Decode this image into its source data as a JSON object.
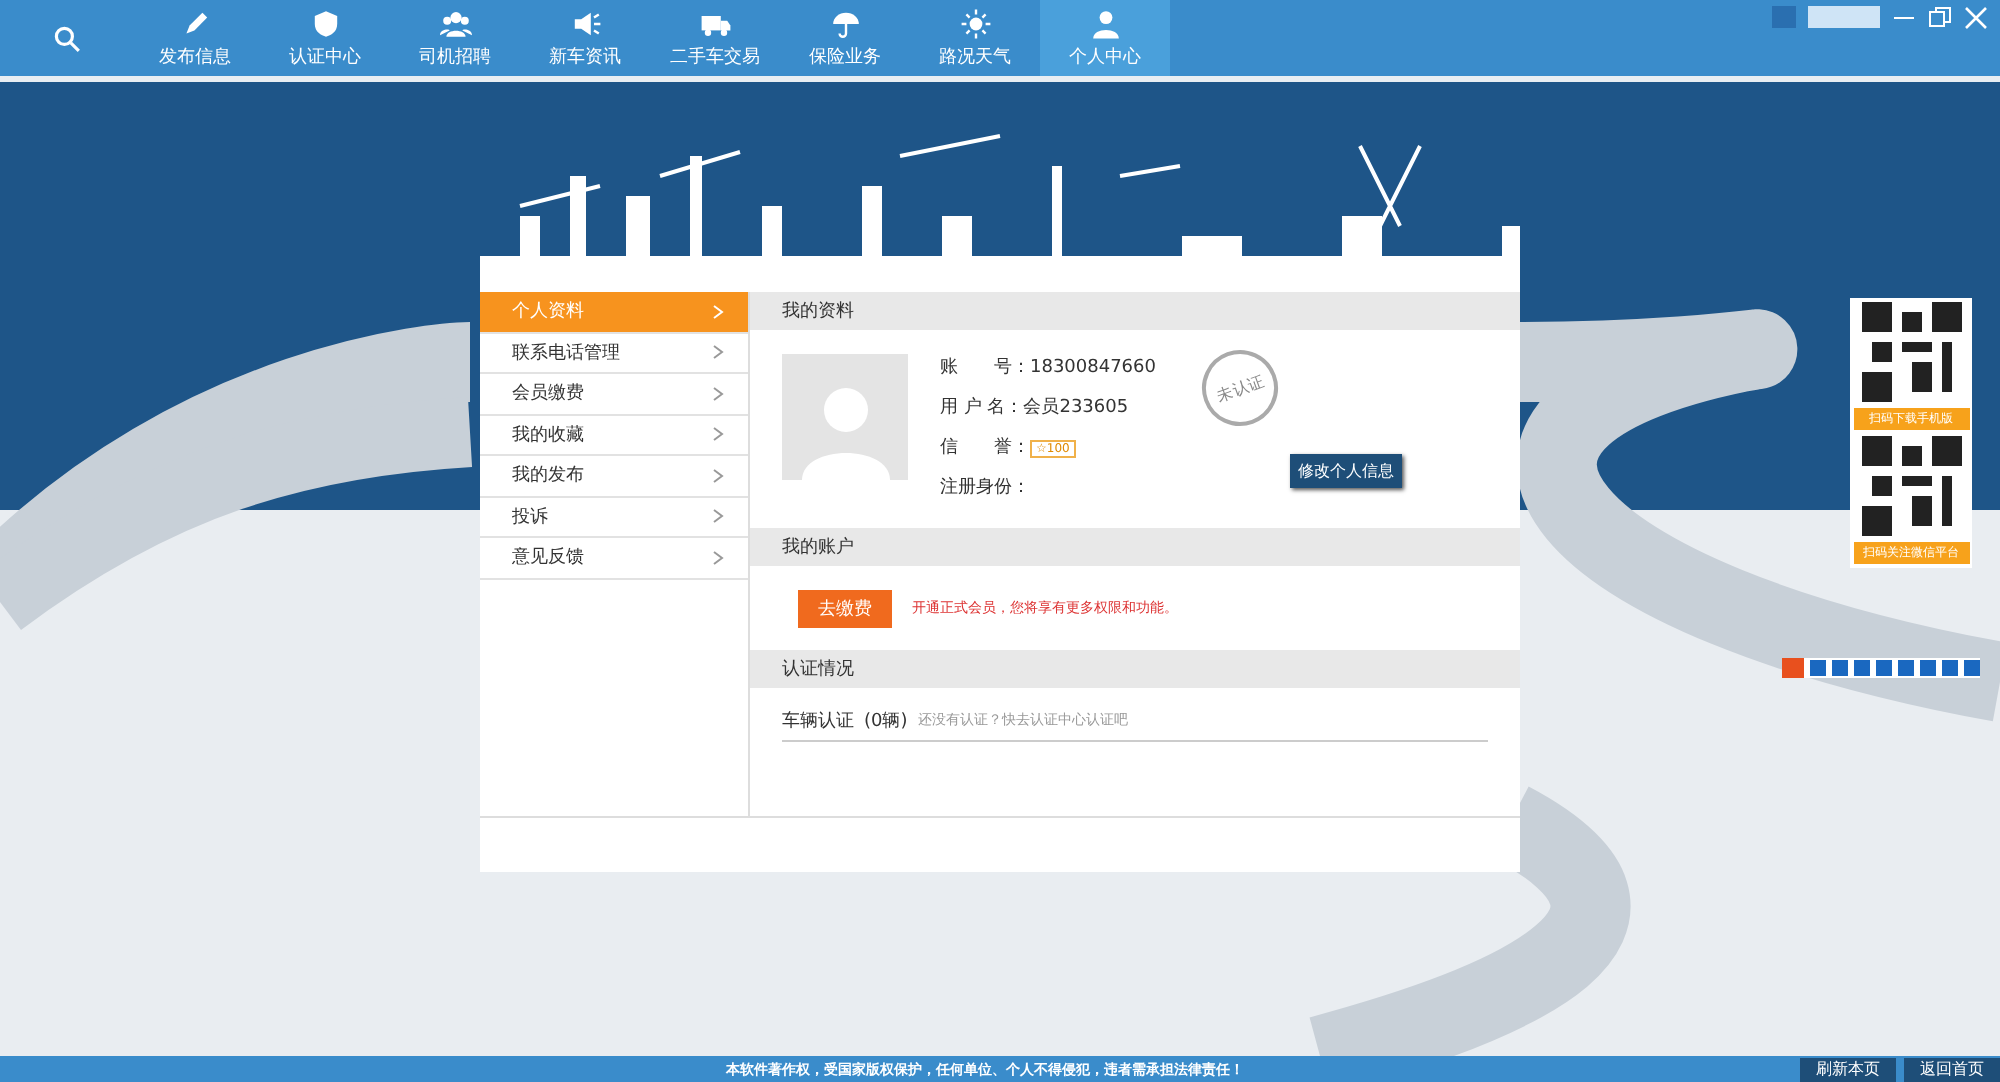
{
  "nav": {
    "tabs": [
      {
        "selected": false
      },
      {
        "label": "发布信息",
        "selected": false
      },
      {
        "label": "认证中心",
        "selected": false
      },
      {
        "label": "司机招聘",
        "selected": false
      },
      {
        "label": "新车资讯",
        "selected": false
      },
      {
        "label": "二手车交易",
        "selected": false
      },
      {
        "label": "保险业务",
        "selected": false
      },
      {
        "label": "路况天气",
        "selected": false
      },
      {
        "label": "个人中心",
        "selected": true
      }
    ]
  },
  "sidebar": {
    "items": [
      {
        "label": "个人资料",
        "selected": true
      },
      {
        "label": "联系电话管理",
        "selected": false
      },
      {
        "label": "会员缴费",
        "selected": false
      },
      {
        "label": "我的收藏",
        "selected": false
      },
      {
        "label": "我的发布",
        "selected": false
      },
      {
        "label": "投诉",
        "selected": false
      },
      {
        "label": "意见反馈",
        "selected": false
      }
    ]
  },
  "profile": {
    "title": "我的资料",
    "fields": [
      {
        "label": "账　　号：",
        "value": "18300847660"
      },
      {
        "label": "用 户 名：",
        "value": "会员233605"
      },
      {
        "label": "信　　誉：",
        "kind": "badge",
        "value": "☆100"
      },
      {
        "label": "注册身份："
      }
    ],
    "stamp": "未认证",
    "edit_button": "修改个人信息"
  },
  "account": {
    "title": "我的账户",
    "pay_button": "去缴费",
    "notice": "开通正式会员，您将享有更多权限和功能。"
  },
  "verification": {
    "title": "认证情况",
    "item": "车辆认证",
    "count": "(0辆)",
    "hint": "还没有认证？快去认证中心认证吧"
  },
  "qr_panel": [
    {
      "caption": "扫码下载手机版"
    },
    {
      "caption": "扫码关注微信平台"
    }
  ],
  "status_bar": {
    "text": "本软件著作权，受国家版权保护，任何单位、个人不得侵犯，违者需承担法律责任！",
    "buttons": [
      "刷新本页",
      "返回首页"
    ]
  }
}
